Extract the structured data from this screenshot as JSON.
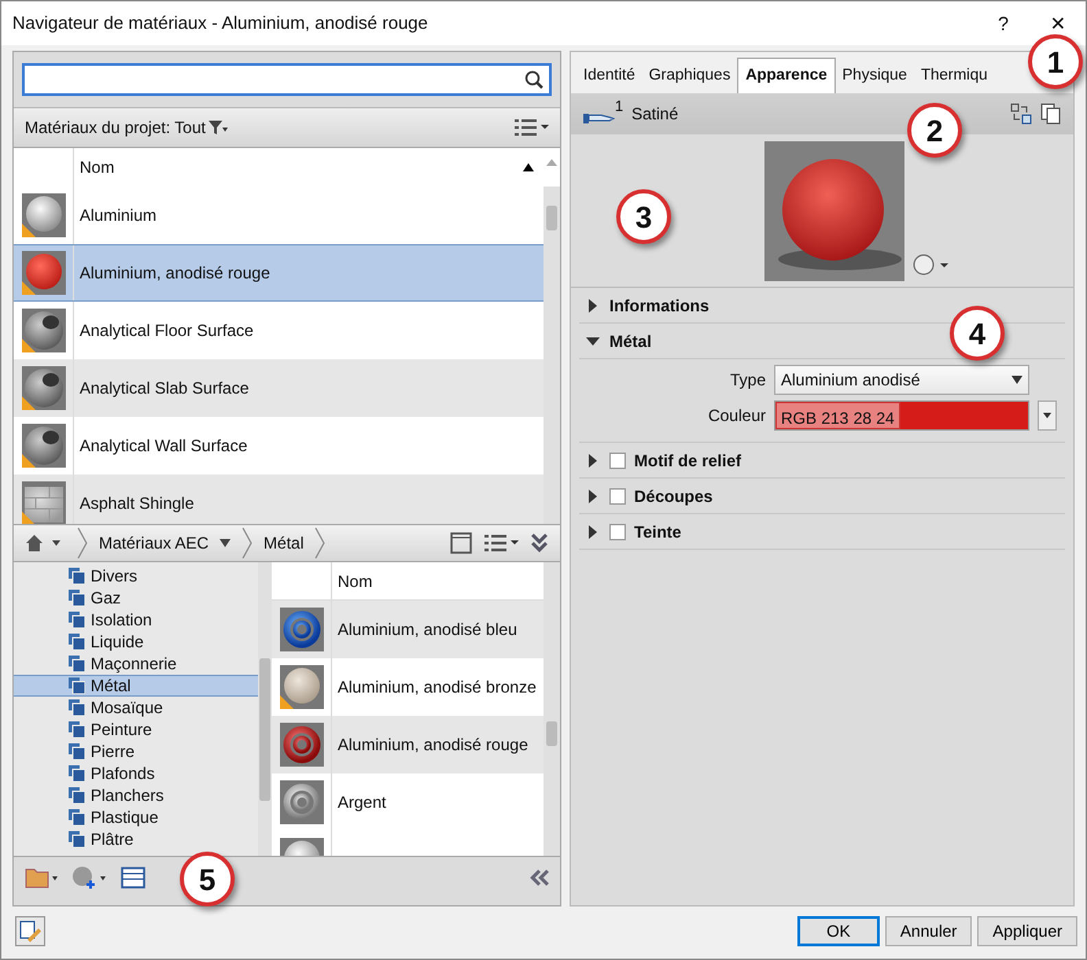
{
  "window": {
    "title": "Navigateur de matériaux - Aluminium, anodisé rouge",
    "help": "?",
    "close": "✕"
  },
  "library": {
    "filter_label": "Matériaux du projet: Tout",
    "column": "Nom",
    "rows": [
      {
        "name": "Aluminium",
        "kind": "sphere-grey",
        "warning": true,
        "selected": false
      },
      {
        "name": "Aluminium, anodisé rouge",
        "kind": "sphere-red",
        "warning": true,
        "selected": true
      },
      {
        "name": "Analytical Floor Surface",
        "kind": "pipe",
        "warning": true,
        "selected": false
      },
      {
        "name": "Analytical Slab Surface",
        "kind": "pipe",
        "warning": true,
        "selected": false
      },
      {
        "name": "Analytical Wall Surface",
        "kind": "pipe",
        "warning": true,
        "selected": false
      },
      {
        "name": "Asphalt Shingle",
        "kind": "brick",
        "warning": true,
        "selected": false
      }
    ]
  },
  "browser": {
    "breadcrumb": [
      "Matériaux AEC",
      "Métal"
    ],
    "tree": [
      {
        "label": "Divers",
        "selected": false
      },
      {
        "label": "Gaz",
        "selected": false
      },
      {
        "label": "Isolation",
        "selected": false
      },
      {
        "label": "Liquide",
        "selected": false
      },
      {
        "label": "Maçonnerie",
        "selected": false
      },
      {
        "label": "Métal",
        "selected": true
      },
      {
        "label": "Mosaïque",
        "selected": false
      },
      {
        "label": "Peinture",
        "selected": false
      },
      {
        "label": "Pierre",
        "selected": false
      },
      {
        "label": "Plafonds",
        "selected": false
      },
      {
        "label": "Planchers",
        "selected": false
      },
      {
        "label": "Plastique",
        "selected": false
      },
      {
        "label": "Plâtre",
        "selected": false
      }
    ],
    "column": "Nom",
    "rows": [
      {
        "name": "Aluminium, anodisé bleu",
        "kind": "ring-blue",
        "warning": false
      },
      {
        "name": "Aluminium, anodisé bronze",
        "kind": "sphere-beige",
        "warning": true
      },
      {
        "name": "Aluminium, anodisé rouge",
        "kind": "ring-red",
        "warning": false
      },
      {
        "name": "Argent",
        "kind": "ring-grey",
        "warning": false
      }
    ]
  },
  "editor": {
    "tabs": [
      {
        "label": "Identité",
        "selected": false
      },
      {
        "label": "Graphiques",
        "selected": false
      },
      {
        "label": "Apparence",
        "selected": true
      },
      {
        "label": "Physique",
        "selected": false
      },
      {
        "label": "Thermiqu",
        "selected": false
      }
    ],
    "asset": {
      "count": "1",
      "name": "Satiné"
    },
    "sections": [
      {
        "title": "Informations",
        "expanded": false
      },
      {
        "title": "Métal",
        "expanded": true,
        "fields": [
          {
            "label": "Type",
            "kind": "select",
            "value": "Aluminium anodisé"
          },
          {
            "label": "Couleur",
            "kind": "color",
            "value": "RGB 213 28 24",
            "color": "#d51c18"
          }
        ]
      },
      {
        "title": "Motif de relief",
        "expanded": false,
        "checked": false
      },
      {
        "title": "Découpes",
        "expanded": false,
        "checked": false
      },
      {
        "title": "Teinte",
        "expanded": false,
        "checked": false
      }
    ]
  },
  "buttons": [
    {
      "label": "OK",
      "default": true
    },
    {
      "label": "Annuler",
      "default": false
    },
    {
      "label": "Appliquer",
      "default": false
    }
  ],
  "callouts": [
    "1",
    "2",
    "3",
    "4",
    "5"
  ]
}
